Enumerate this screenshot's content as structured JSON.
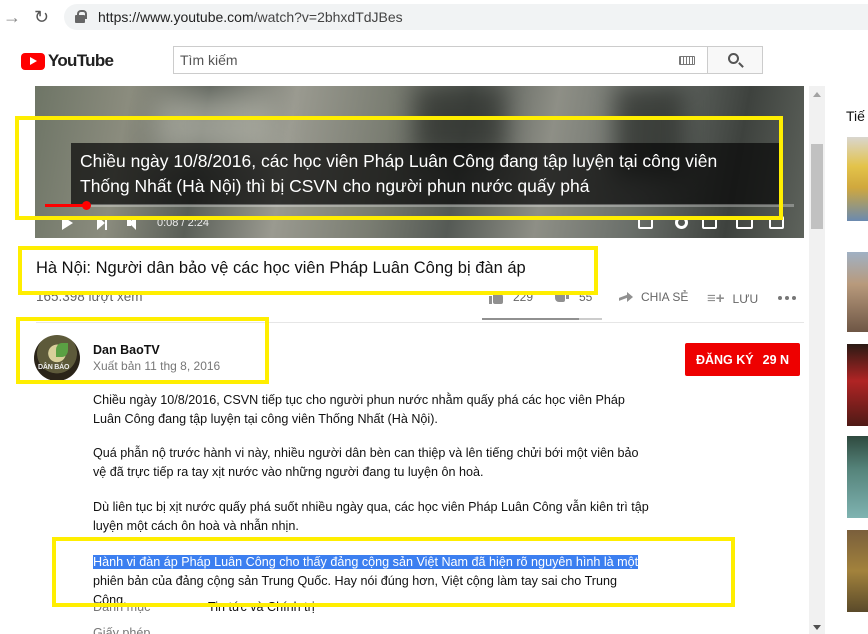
{
  "browser": {
    "url_host": "https://www.youtube.com",
    "url_path": "/watch?v=2bhxdTdJBes"
  },
  "header": {
    "logo_text": "YouTube",
    "search_placeholder": "Tìm kiếm"
  },
  "player": {
    "subtitle": "Chiều ngày 10/8/2016, các học viên Pháp Luân Công đang tập luyện tại công viên Thống Nhất (Hà Nội) thì bị CSVN cho người phun nước quấy phá",
    "time_display": "0:08 / 2:24",
    "progress_fraction": 0.055
  },
  "video": {
    "title": "Hà Nội: Người dân bảo vệ các học viên Pháp Luân Công bị đàn áp",
    "views": "165.398 lượt xem",
    "like_count": "229",
    "dislike_count": "55",
    "share_label": "CHIA SẺ",
    "save_label": "LƯU",
    "like_ratio": 0.81
  },
  "channel": {
    "name": "Dan BaoTV",
    "avatar_text": "DÂN BÁO",
    "published": "Xuất bản 11 thg 8, 2016",
    "subscribe_label": "ĐĂNG KÝ",
    "subscriber_count": "29 N"
  },
  "description": {
    "p1": "Chiều ngày 10/8/2016, CSVN tiếp tục cho người phun nước nhằm quấy phá các học viên Pháp Luân Công đang tập luyện tại công viên Thống Nhất (Hà Nội).",
    "p2": "Quá phẫn nộ trước hành vi này, nhiều người dân bèn can thiệp và lên tiếng chửi bới một viên bảo vệ đã trực tiếp ra tay xịt nước vào những người đang tu luyện ôn hoà.",
    "p3": "Dù liên tục bị xịt nước quấy phá suốt nhiều ngày qua, các học viên Pháp Luân Công vẫn kiên trì tập luyện một cách ôn hoà và nhẫn nhịn.",
    "p4_highlight": "Hành vi đàn áp Pháp Luân Công cho thấy đảng cộng sản Việt Nam đã hiện rõ nguyên hình là một",
    "p4_rest": "phiên bản của đảng cộng sản Trung Quốc. Hay nói đúng hơn, Việt cộng làm tay sai cho Trung Cộng.",
    "category_label": "Danh mục",
    "category_value": "Tin tức và Chính trị",
    "license_label": "Giấy phép"
  },
  "sidebar": {
    "heading": "Tiế"
  },
  "colors": {
    "accent_red": "#ff0000",
    "annotation_yellow": "#ffee00",
    "selection_blue": "#3c7ff0"
  }
}
